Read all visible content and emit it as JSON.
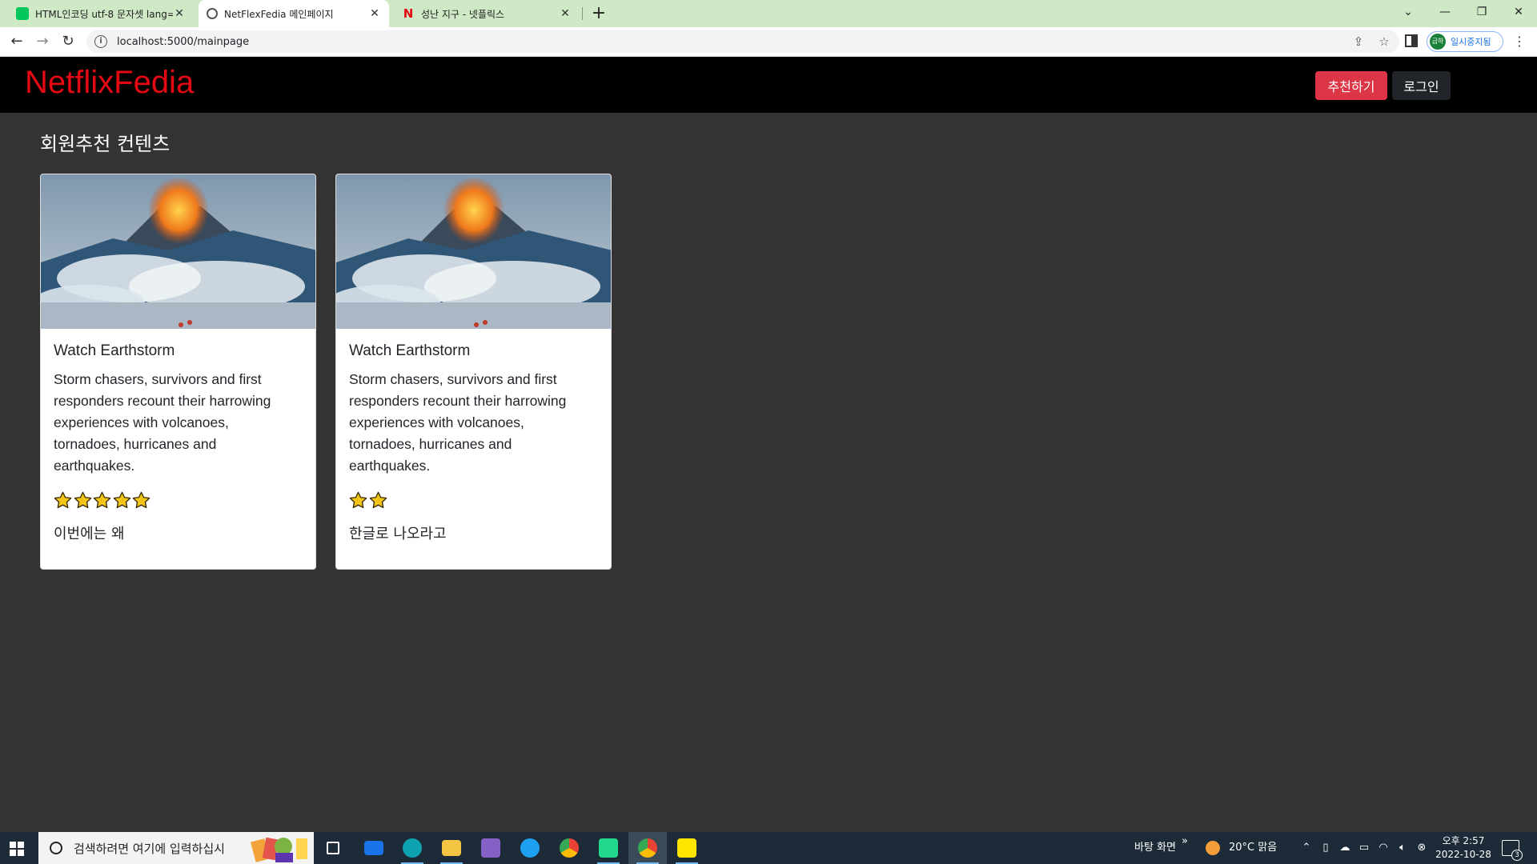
{
  "browser": {
    "tabs": [
      {
        "title": "HTML인코딩 utf-8 문자셋 lang=",
        "favicon": "naver-blog-icon",
        "active": false
      },
      {
        "title": "NetFlexFedia 메인페이지",
        "favicon": "globe-icon",
        "active": true
      },
      {
        "title": "성난 지구 - 넷플릭스",
        "favicon": "netflix-icon",
        "active": false
      }
    ],
    "url": "localhost:5000/mainpage",
    "profile_label": "일시중지됨",
    "profile_avatar_text": "금하"
  },
  "navbar": {
    "brand": "NetflixFedia",
    "recommend_button": "추천하기",
    "login_button": "로그인"
  },
  "main": {
    "section_title": "회원추천 컨텐츠",
    "cards": [
      {
        "title": "Watch Earthstorm",
        "description": "Storm chasers, survivors and first responders recount their harrowing experiences with volcanoes, tornadoes, hurricanes and earthquakes.",
        "rating": 5,
        "comment": "이번에는 왜"
      },
      {
        "title": "Watch Earthstorm",
        "description": "Storm chasers, survivors and first responders recount their harrowing experiences with volcanoes, tornadoes, hurricanes and earthquakes.",
        "rating": 2,
        "comment": "한글로 나오라고"
      }
    ]
  },
  "taskbar": {
    "search_placeholder": "검색하려면 여기에 입력하십시",
    "desktop_label": "바탕 화면",
    "weather": "20°C  맑음",
    "time": "오후 2:57",
    "date": "2022-10-28",
    "notification_count": "3"
  },
  "colors": {
    "brand_red": "#e50914",
    "recommend_red": "#dc3545",
    "page_bg": "#333333",
    "star_fill": "#f5c518"
  }
}
